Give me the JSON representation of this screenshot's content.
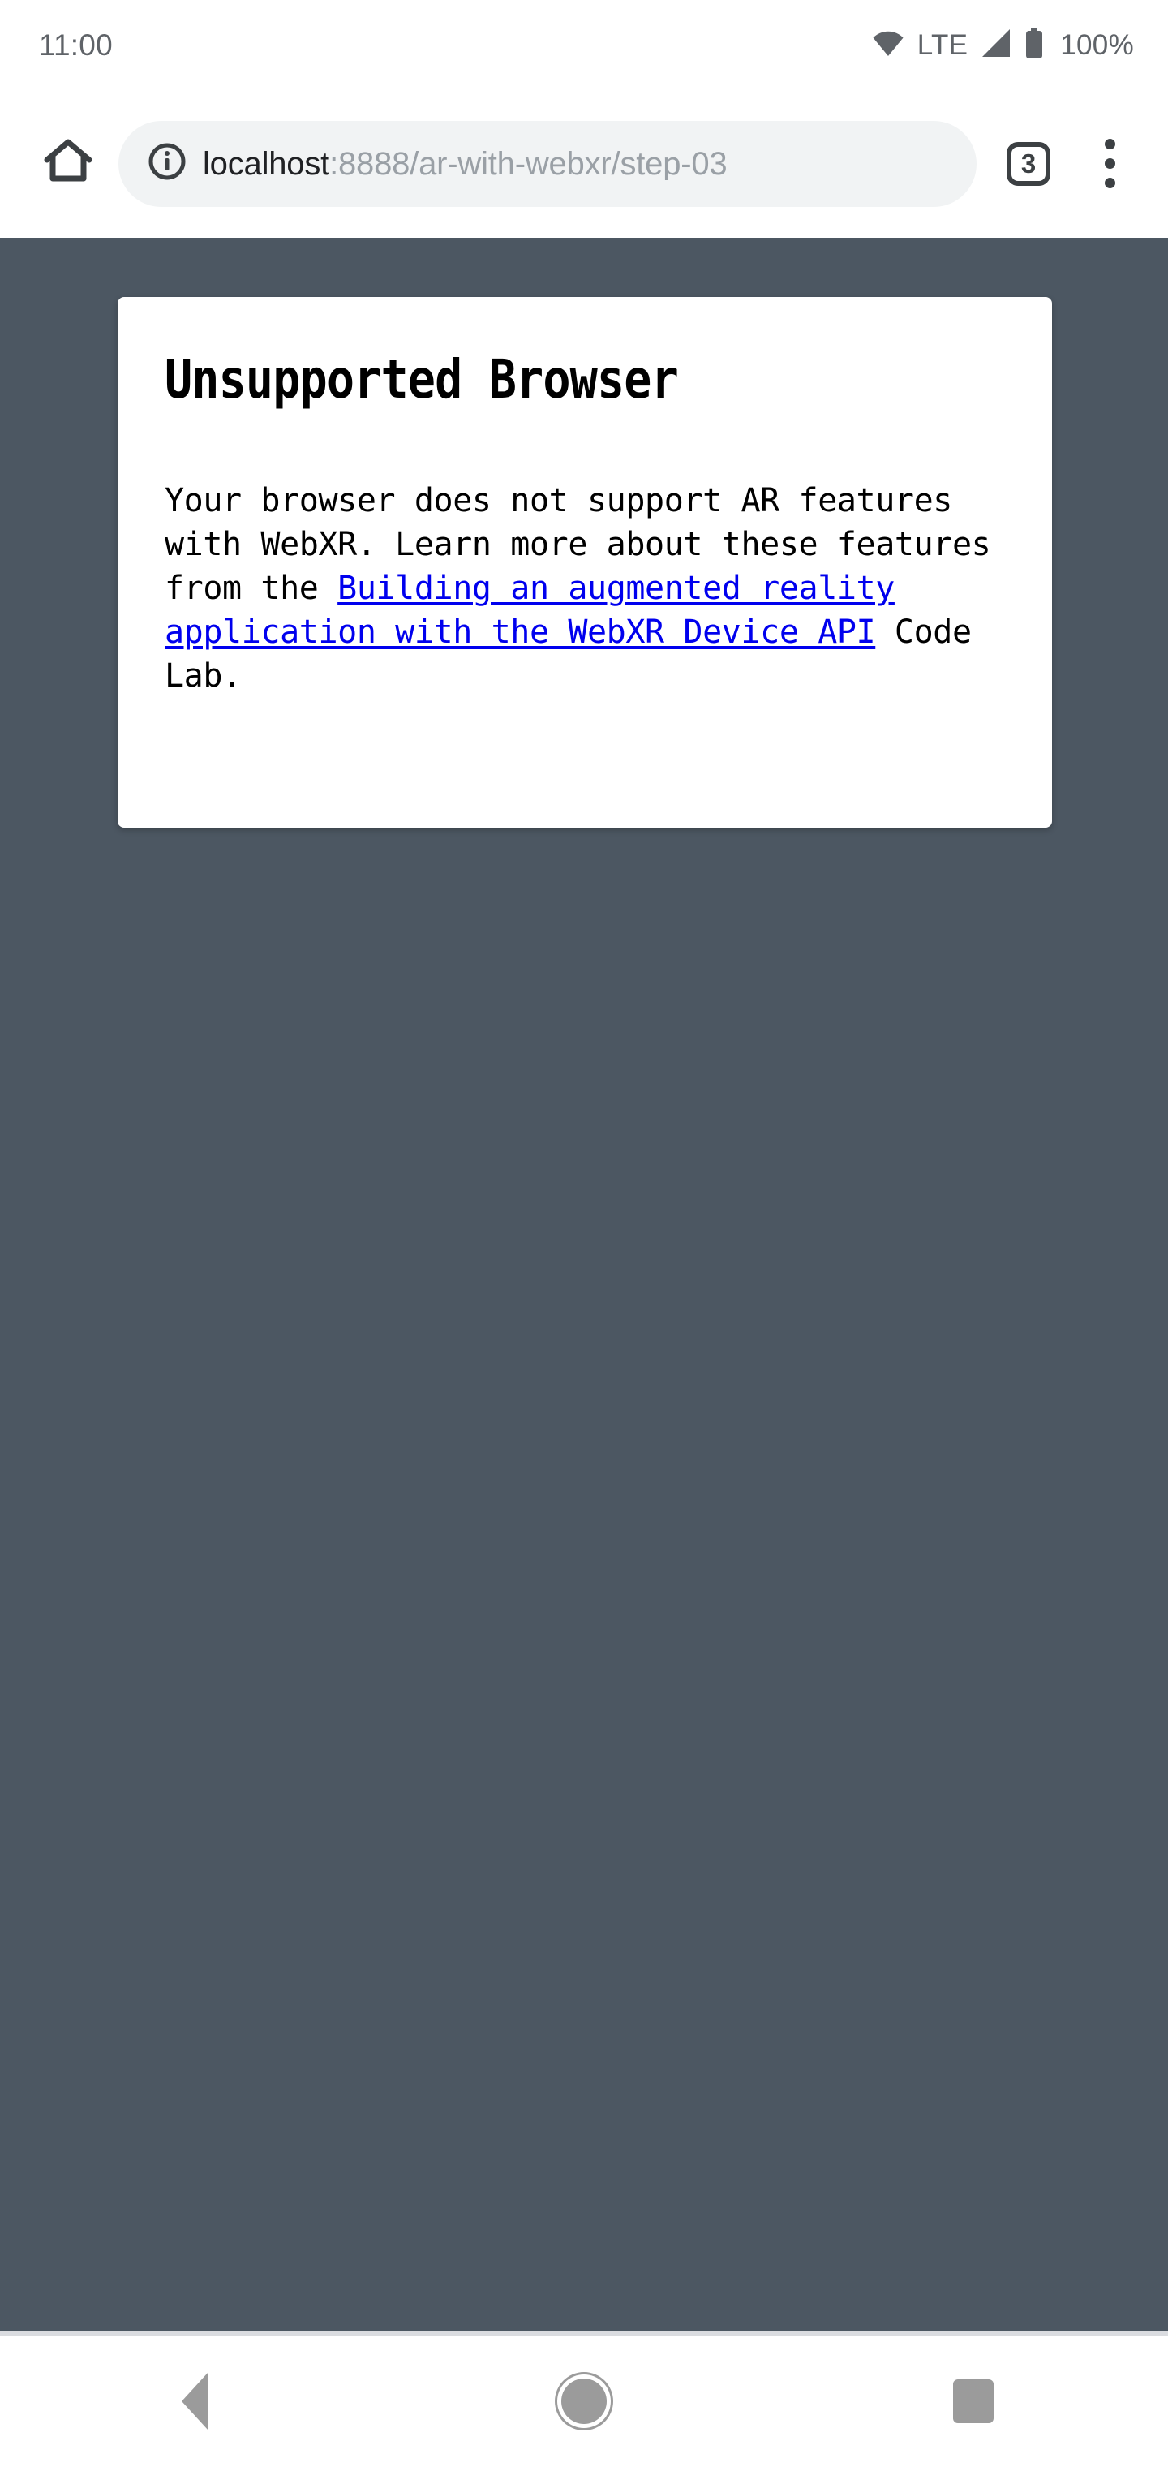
{
  "status_bar": {
    "clock": "11:00",
    "wifi_icon": "wifi-icon",
    "network_label": "LTE",
    "signal_icon": "signal-bars-icon",
    "battery_icon": "battery-full-icon",
    "battery_label": "100%"
  },
  "browser": {
    "home_icon": "home-icon",
    "site_info_icon": "info-circle-icon",
    "url_host": "localhost",
    "url_path": ":8888/ar-with-webxr/step-03",
    "url_full": "localhost:8888/ar-with-webxr/step-03",
    "tab_count": "3",
    "overflow_icon": "three-dot-menu-icon"
  },
  "page": {
    "background_color": "#4c5762",
    "card": {
      "title": "Unsupported Browser",
      "body_before_link": "Your browser does not support AR features with WebXR. Learn more about these features from the ",
      "link_text": "Building an augmented reality application with the WebXR Device API",
      "link_color": "#0000ee",
      "body_after_link": " Code Lab."
    }
  },
  "system_nav": {
    "back_label": "Back",
    "home_label": "Home",
    "recents_label": "Recent apps"
  }
}
